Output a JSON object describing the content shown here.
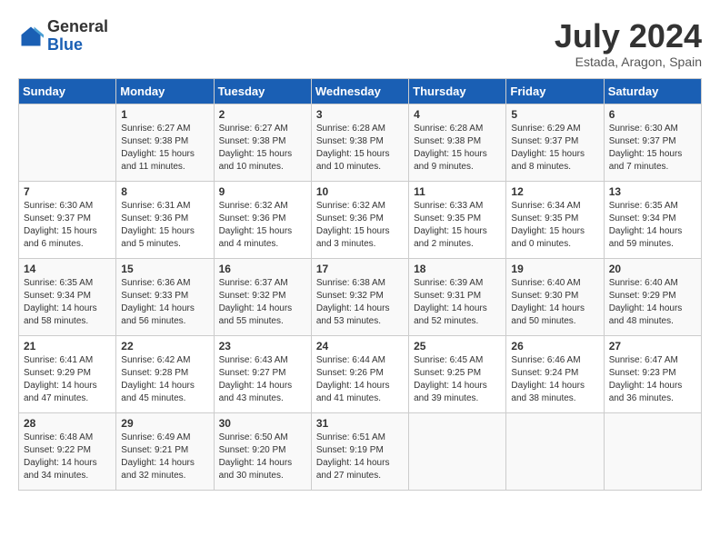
{
  "header": {
    "logo_general": "General",
    "logo_blue": "Blue",
    "month": "July 2024",
    "location": "Estada, Aragon, Spain"
  },
  "days_of_week": [
    "Sunday",
    "Monday",
    "Tuesday",
    "Wednesday",
    "Thursday",
    "Friday",
    "Saturday"
  ],
  "weeks": [
    [
      {
        "day": "",
        "info": ""
      },
      {
        "day": "1",
        "info": "Sunrise: 6:27 AM\nSunset: 9:38 PM\nDaylight: 15 hours\nand 11 minutes."
      },
      {
        "day": "2",
        "info": "Sunrise: 6:27 AM\nSunset: 9:38 PM\nDaylight: 15 hours\nand 10 minutes."
      },
      {
        "day": "3",
        "info": "Sunrise: 6:28 AM\nSunset: 9:38 PM\nDaylight: 15 hours\nand 10 minutes."
      },
      {
        "day": "4",
        "info": "Sunrise: 6:28 AM\nSunset: 9:38 PM\nDaylight: 15 hours\nand 9 minutes."
      },
      {
        "day": "5",
        "info": "Sunrise: 6:29 AM\nSunset: 9:37 PM\nDaylight: 15 hours\nand 8 minutes."
      },
      {
        "day": "6",
        "info": "Sunrise: 6:30 AM\nSunset: 9:37 PM\nDaylight: 15 hours\nand 7 minutes."
      }
    ],
    [
      {
        "day": "7",
        "info": "Sunrise: 6:30 AM\nSunset: 9:37 PM\nDaylight: 15 hours\nand 6 minutes."
      },
      {
        "day": "8",
        "info": "Sunrise: 6:31 AM\nSunset: 9:36 PM\nDaylight: 15 hours\nand 5 minutes."
      },
      {
        "day": "9",
        "info": "Sunrise: 6:32 AM\nSunset: 9:36 PM\nDaylight: 15 hours\nand 4 minutes."
      },
      {
        "day": "10",
        "info": "Sunrise: 6:32 AM\nSunset: 9:36 PM\nDaylight: 15 hours\nand 3 minutes."
      },
      {
        "day": "11",
        "info": "Sunrise: 6:33 AM\nSunset: 9:35 PM\nDaylight: 15 hours\nand 2 minutes."
      },
      {
        "day": "12",
        "info": "Sunrise: 6:34 AM\nSunset: 9:35 PM\nDaylight: 15 hours\nand 0 minutes."
      },
      {
        "day": "13",
        "info": "Sunrise: 6:35 AM\nSunset: 9:34 PM\nDaylight: 14 hours\nand 59 minutes."
      }
    ],
    [
      {
        "day": "14",
        "info": "Sunrise: 6:35 AM\nSunset: 9:34 PM\nDaylight: 14 hours\nand 58 minutes."
      },
      {
        "day": "15",
        "info": "Sunrise: 6:36 AM\nSunset: 9:33 PM\nDaylight: 14 hours\nand 56 minutes."
      },
      {
        "day": "16",
        "info": "Sunrise: 6:37 AM\nSunset: 9:32 PM\nDaylight: 14 hours\nand 55 minutes."
      },
      {
        "day": "17",
        "info": "Sunrise: 6:38 AM\nSunset: 9:32 PM\nDaylight: 14 hours\nand 53 minutes."
      },
      {
        "day": "18",
        "info": "Sunrise: 6:39 AM\nSunset: 9:31 PM\nDaylight: 14 hours\nand 52 minutes."
      },
      {
        "day": "19",
        "info": "Sunrise: 6:40 AM\nSunset: 9:30 PM\nDaylight: 14 hours\nand 50 minutes."
      },
      {
        "day": "20",
        "info": "Sunrise: 6:40 AM\nSunset: 9:29 PM\nDaylight: 14 hours\nand 48 minutes."
      }
    ],
    [
      {
        "day": "21",
        "info": "Sunrise: 6:41 AM\nSunset: 9:29 PM\nDaylight: 14 hours\nand 47 minutes."
      },
      {
        "day": "22",
        "info": "Sunrise: 6:42 AM\nSunset: 9:28 PM\nDaylight: 14 hours\nand 45 minutes."
      },
      {
        "day": "23",
        "info": "Sunrise: 6:43 AM\nSunset: 9:27 PM\nDaylight: 14 hours\nand 43 minutes."
      },
      {
        "day": "24",
        "info": "Sunrise: 6:44 AM\nSunset: 9:26 PM\nDaylight: 14 hours\nand 41 minutes."
      },
      {
        "day": "25",
        "info": "Sunrise: 6:45 AM\nSunset: 9:25 PM\nDaylight: 14 hours\nand 39 minutes."
      },
      {
        "day": "26",
        "info": "Sunrise: 6:46 AM\nSunset: 9:24 PM\nDaylight: 14 hours\nand 38 minutes."
      },
      {
        "day": "27",
        "info": "Sunrise: 6:47 AM\nSunset: 9:23 PM\nDaylight: 14 hours\nand 36 minutes."
      }
    ],
    [
      {
        "day": "28",
        "info": "Sunrise: 6:48 AM\nSunset: 9:22 PM\nDaylight: 14 hours\nand 34 minutes."
      },
      {
        "day": "29",
        "info": "Sunrise: 6:49 AM\nSunset: 9:21 PM\nDaylight: 14 hours\nand 32 minutes."
      },
      {
        "day": "30",
        "info": "Sunrise: 6:50 AM\nSunset: 9:20 PM\nDaylight: 14 hours\nand 30 minutes."
      },
      {
        "day": "31",
        "info": "Sunrise: 6:51 AM\nSunset: 9:19 PM\nDaylight: 14 hours\nand 27 minutes."
      },
      {
        "day": "",
        "info": ""
      },
      {
        "day": "",
        "info": ""
      },
      {
        "day": "",
        "info": ""
      }
    ]
  ]
}
